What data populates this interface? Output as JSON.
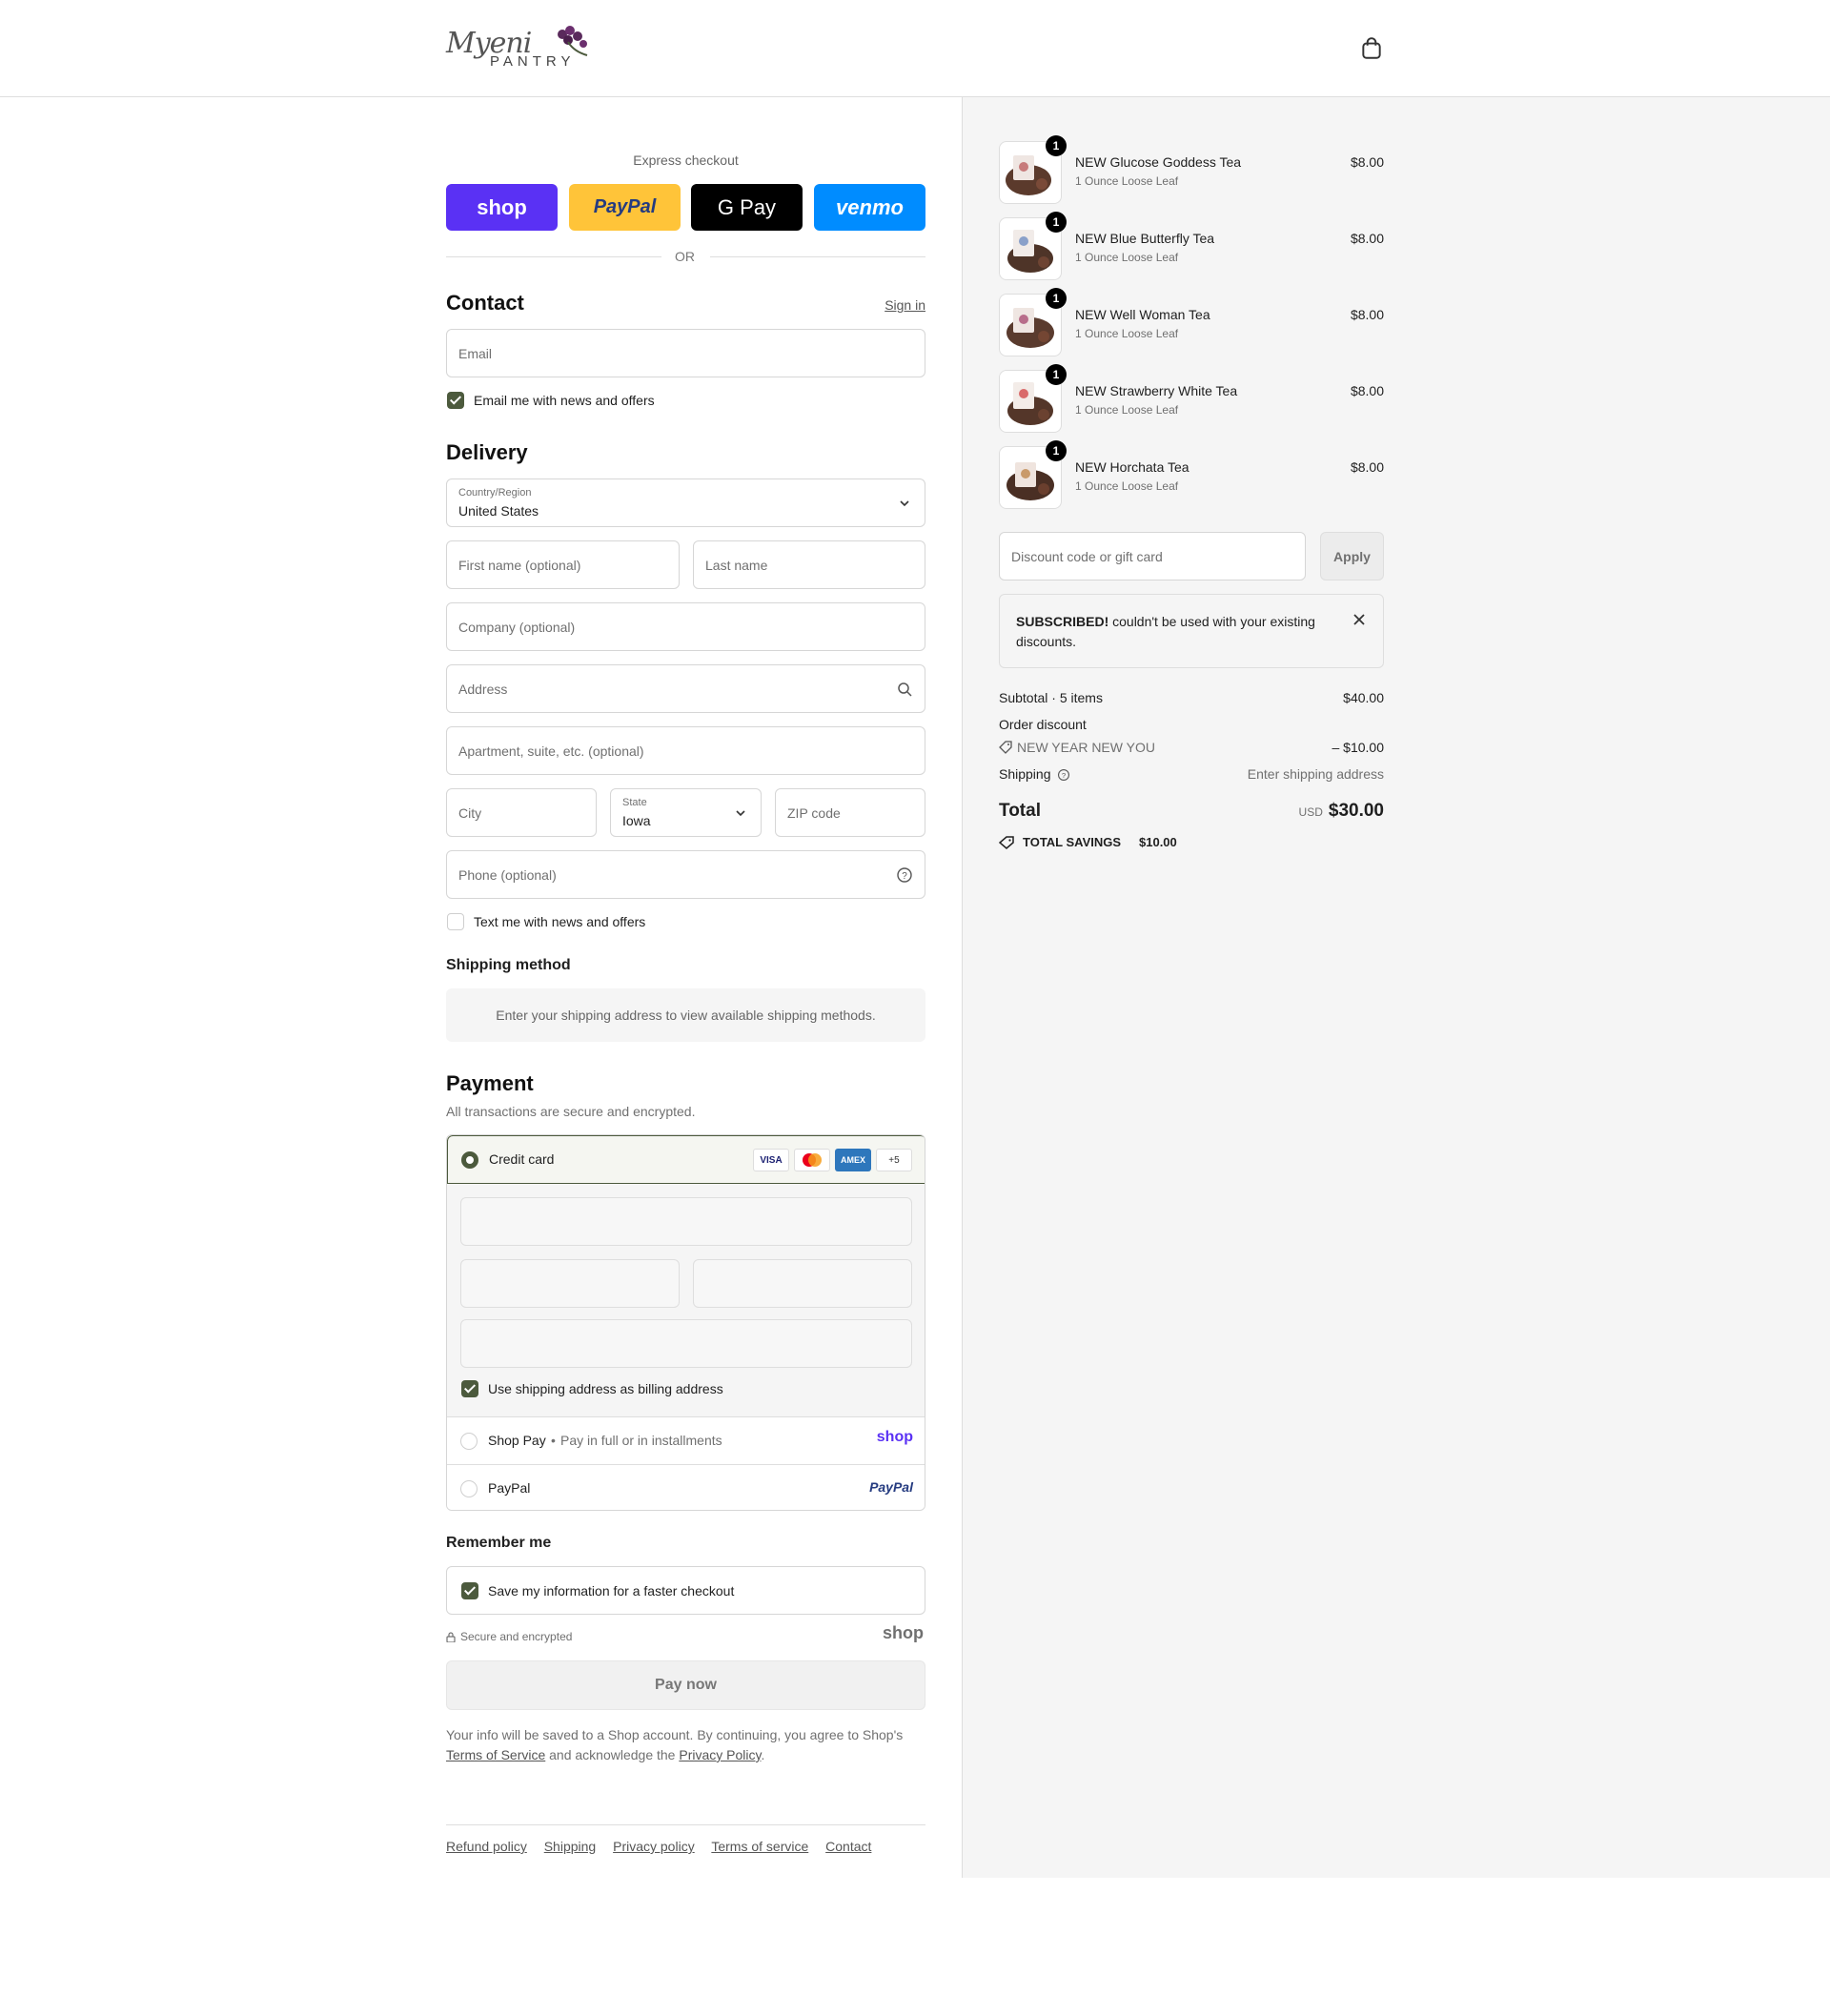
{
  "header": {
    "logo_script": "Myeni",
    "logo_text": "PANTRY",
    "cart_icon": "shopping-bag-icon"
  },
  "express": {
    "title": "Express checkout",
    "shop_label": "shop",
    "paypal_label": "PayPal",
    "gpay_label": "G Pay",
    "venmo_label": "venmo",
    "or_label": "OR"
  },
  "contact": {
    "heading": "Contact",
    "sign_in": "Sign in",
    "email_placeholder": "Email",
    "email_news_label": "Email me with news and offers",
    "email_news_checked": true
  },
  "delivery": {
    "heading": "Delivery",
    "country_label": "Country/Region",
    "country_value": "United States",
    "first_name_placeholder": "First name (optional)",
    "last_name_placeholder": "Last name",
    "company_placeholder": "Company (optional)",
    "address_placeholder": "Address",
    "apartment_placeholder": "Apartment, suite, etc. (optional)",
    "city_placeholder": "City",
    "state_label": "State",
    "state_value": "Iowa",
    "zip_placeholder": "ZIP code",
    "phone_placeholder": "Phone (optional)",
    "text_news_label": "Text me with news and offers",
    "text_news_checked": false
  },
  "shipping_method": {
    "heading": "Shipping method",
    "message": "Enter your shipping address to view available shipping methods."
  },
  "payment": {
    "heading": "Payment",
    "subheading": "All transactions are secure and encrypted.",
    "credit_card_label": "Credit card",
    "card_brands": [
      "VISA",
      "MC",
      "AMEX",
      "+5"
    ],
    "billing_same_label": "Use shipping address as billing address",
    "shop_pay_label": "Shop Pay",
    "shop_pay_desc": "Pay in full or in installments",
    "shop_pay_logo": "shop",
    "paypal_label": "PayPal",
    "paypal_logo": "PayPal"
  },
  "remember": {
    "heading": "Remember me",
    "save_label": "Save my information for a faster checkout",
    "secure_label": "Secure and encrypted",
    "shop_logo": "shop"
  },
  "pay_now": "Pay now",
  "legal": {
    "text1": "Your info will be saved to a Shop account. By continuing, you agree to Shop's ",
    "terms": "Terms of Service",
    "text2": " and acknowledge the ",
    "privacy": "Privacy Policy",
    "text3": "."
  },
  "footer": {
    "links": [
      "Refund policy",
      "Shipping",
      "Privacy policy",
      "Terms of service",
      "Contact"
    ]
  },
  "cart": {
    "items": [
      {
        "name": "NEW Glucose Goddess Tea",
        "variant": "1 Ounce Loose Leaf",
        "price": "$8.00",
        "qty": "1"
      },
      {
        "name": "NEW Blue Butterfly Tea",
        "variant": "1 Ounce Loose Leaf",
        "price": "$8.00",
        "qty": "1"
      },
      {
        "name": "NEW Well Woman Tea",
        "variant": "1 Ounce Loose Leaf",
        "price": "$8.00",
        "qty": "1"
      },
      {
        "name": "NEW Strawberry White Tea",
        "variant": "1 Ounce Loose Leaf",
        "price": "$8.00",
        "qty": "1"
      },
      {
        "name": "NEW Horchata Tea",
        "variant": "1 Ounce Loose Leaf",
        "price": "$8.00",
        "qty": "1"
      }
    ],
    "discount_placeholder": "Discount code or gift card",
    "apply_label": "Apply",
    "notice_bold": "SUBSCRIBED!",
    "notice_text": " couldn't be used with your existing discounts.",
    "subtotal_label": "Subtotal · 5 items",
    "subtotal_value": "$40.00",
    "order_discount_label": "Order discount",
    "discount_code": "NEW YEAR NEW YOU",
    "discount_value": "– $10.00",
    "shipping_label": "Shipping",
    "shipping_value": "Enter shipping address",
    "total_label": "Total",
    "currency": "USD",
    "total_value": "$30.00",
    "savings_label": "TOTAL SAVINGS",
    "savings_value": "$10.00"
  },
  "colors": {
    "accent": "#4c5a3d",
    "shop_purple": "#5a31f4",
    "paypal_yellow": "#ffc439",
    "venmo_blue": "#008cff"
  }
}
